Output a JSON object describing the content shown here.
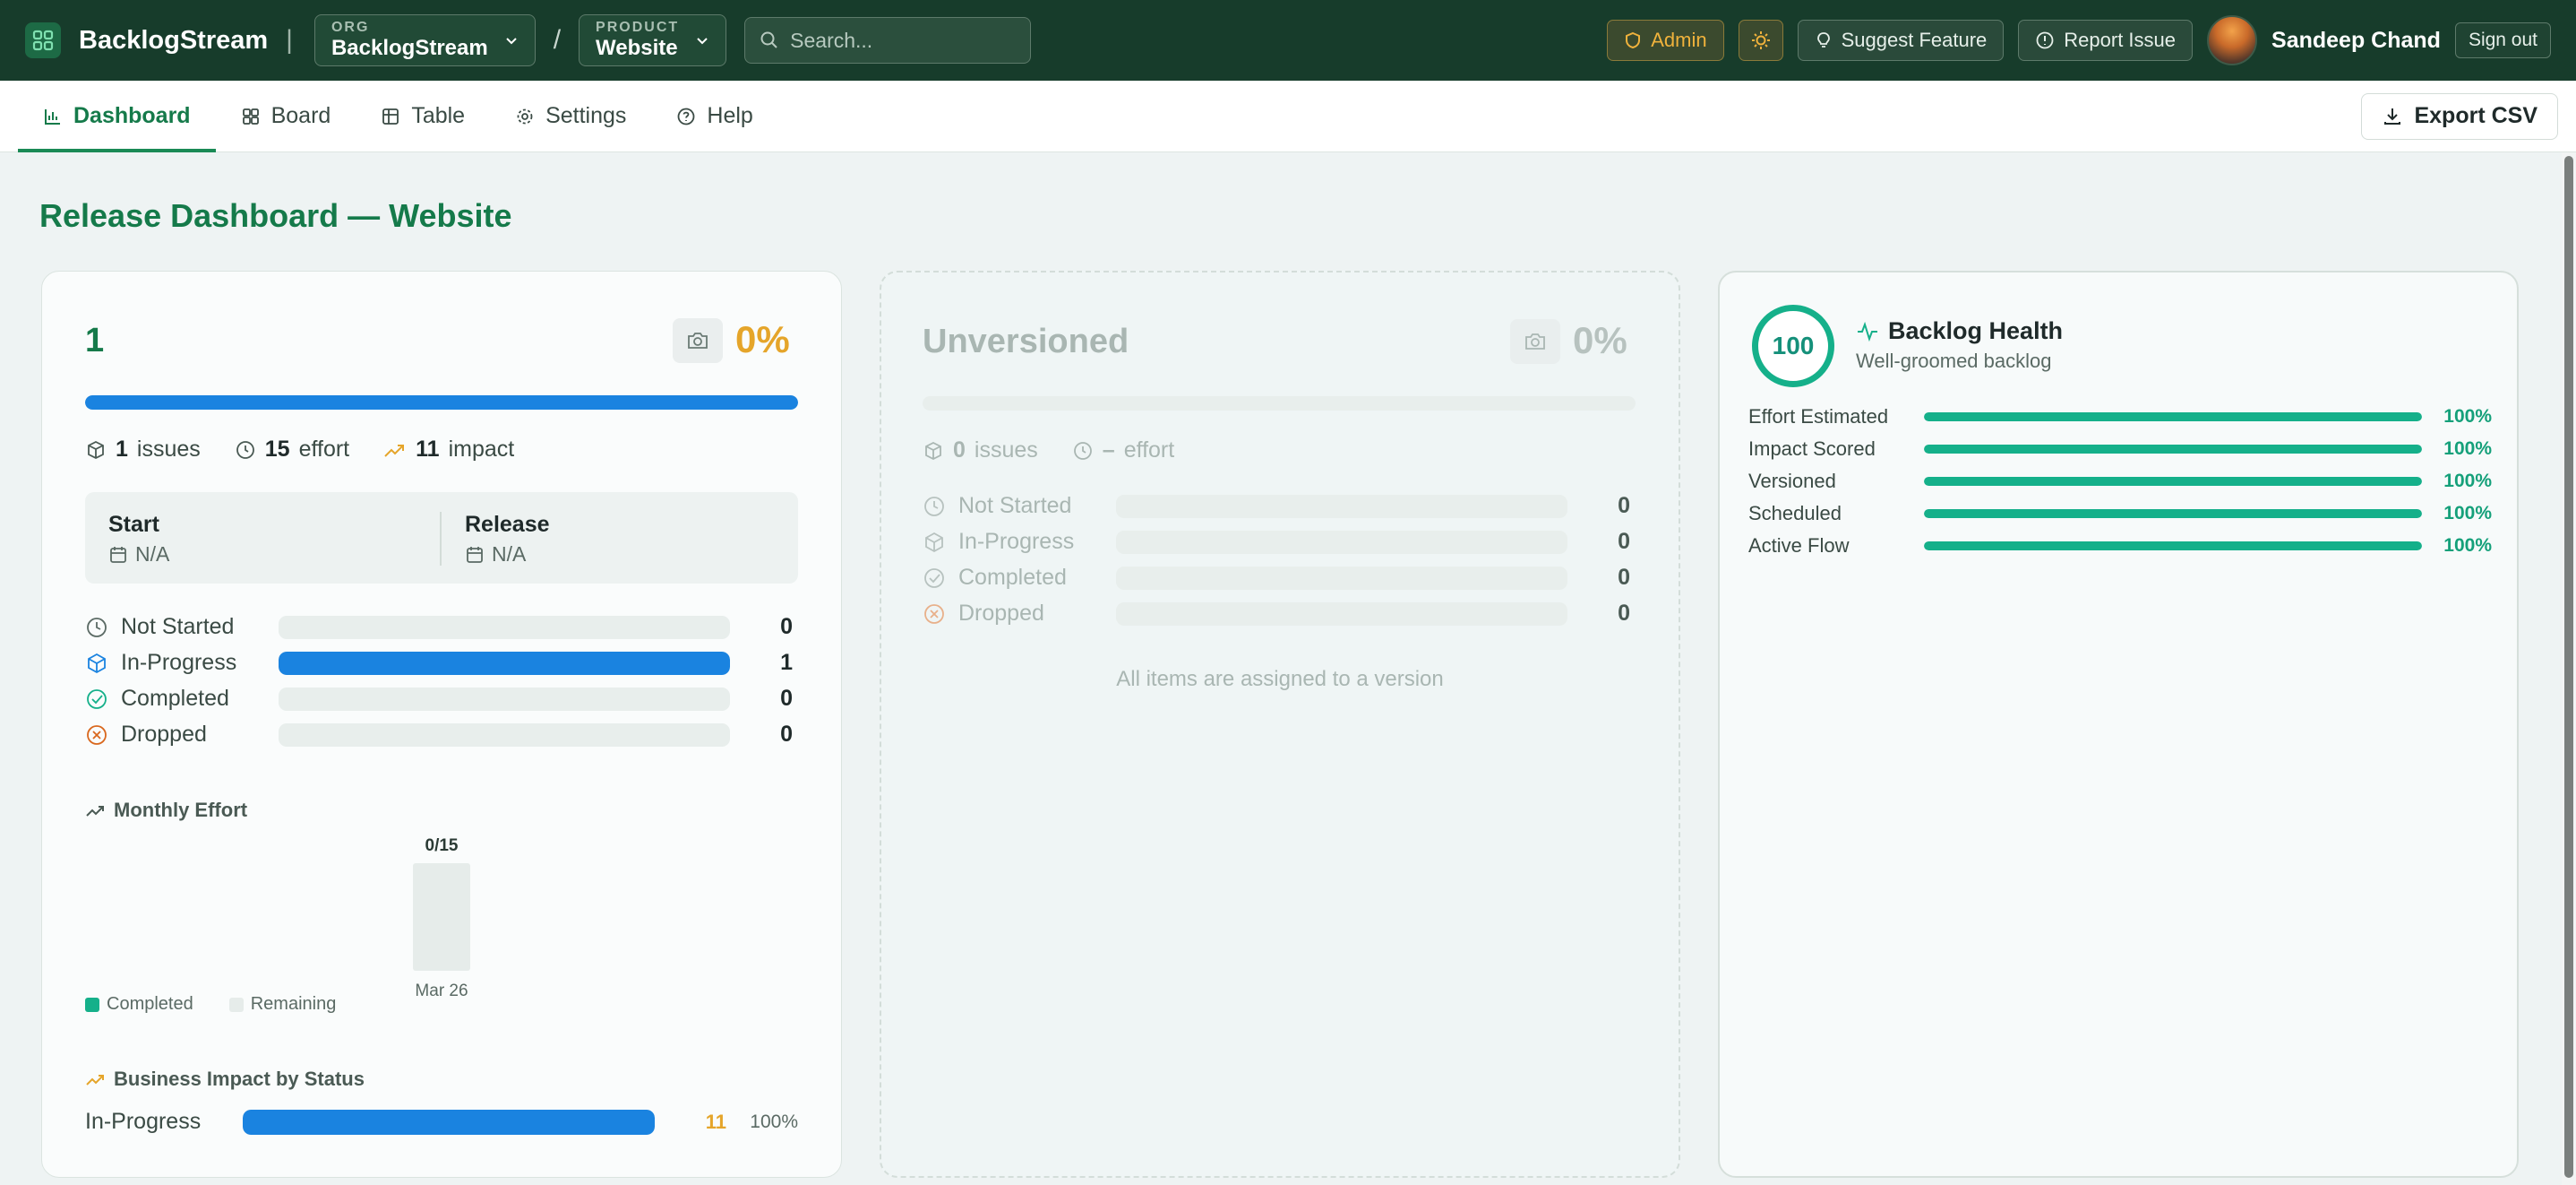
{
  "app": {
    "title": "BacklogStream"
  },
  "org": {
    "caption": "ORG",
    "value": "BacklogStream"
  },
  "product": {
    "caption": "PRODUCT",
    "value": "Website"
  },
  "search": {
    "placeholder": "Search..."
  },
  "topbar": {
    "admin": "Admin",
    "suggest": "Suggest Feature",
    "report": "Report Issue",
    "user": "Sandeep Chand",
    "signout": "Sign out"
  },
  "tabs": [
    {
      "label": "Dashboard",
      "icon": "bar-chart-icon",
      "active": true
    },
    {
      "label": "Board",
      "icon": "grid-icon"
    },
    {
      "label": "Table",
      "icon": "table-icon"
    },
    {
      "label": "Settings",
      "icon": "gear-icon"
    },
    {
      "label": "Help",
      "icon": "help-icon"
    }
  ],
  "export_label": "Export CSV",
  "page_title": "Release Dashboard — Website",
  "version_card": {
    "name": "1",
    "percent": "0%",
    "progress": 1.0,
    "issues_count": "1",
    "issues_label": "issues",
    "effort_count": "15",
    "effort_label": "effort",
    "impact_count": "11",
    "impact_label": "impact",
    "start_label": "Start",
    "start_value": "N/A",
    "release_label": "Release",
    "release_value": "N/A",
    "statuses": [
      {
        "label": "Not Started",
        "count": "0",
        "fill": 0,
        "color": "#5a6a64"
      },
      {
        "label": "In-Progress",
        "count": "1",
        "fill": 1.0,
        "color": "#1a83e0"
      },
      {
        "label": "Completed",
        "count": "0",
        "fill": 0,
        "color": "#15b08a"
      },
      {
        "label": "Dropped",
        "count": "0",
        "fill": 0,
        "color": "#d9681e"
      }
    ],
    "monthly_effort_title": "Monthly Effort",
    "business_impact_title": "Business Impact by Status",
    "business_impact": [
      {
        "label": "In-Progress",
        "value": "11",
        "percent": "100%",
        "fill": 1.0
      }
    ]
  },
  "unversioned_card": {
    "name": "Unversioned",
    "percent": "0%",
    "issues_count": "0",
    "issues_label": "issues",
    "effort_count": "–",
    "effort_label": "effort",
    "statuses": [
      {
        "label": "Not Started",
        "count": "0"
      },
      {
        "label": "In-Progress",
        "count": "0"
      },
      {
        "label": "Completed",
        "count": "0"
      },
      {
        "label": "Dropped",
        "count": "0"
      }
    ],
    "empty_message": "All items are assigned to a version"
  },
  "health_card": {
    "score": "100",
    "title": "Backlog Health",
    "subtitle": "Well-groomed backlog",
    "metrics": [
      {
        "label": "Effort Estimated",
        "value": "100%",
        "fill": 1.0
      },
      {
        "label": "Impact Scored",
        "value": "100%",
        "fill": 1.0
      },
      {
        "label": "Versioned",
        "value": "100%",
        "fill": 1.0
      },
      {
        "label": "Scheduled",
        "value": "100%",
        "fill": 1.0
      },
      {
        "label": "Active Flow",
        "value": "100%",
        "fill": 1.0
      }
    ]
  },
  "chart_data": {
    "type": "bar",
    "title": "Monthly Effort",
    "categories": [
      "Mar 26"
    ],
    "series": [
      {
        "name": "Completed",
        "values": [
          0
        ]
      },
      {
        "name": "Remaining",
        "values": [
          15
        ]
      }
    ],
    "data_labels": [
      "0/15"
    ],
    "legend": "bottom-left"
  },
  "colors": {
    "brand": "#157a4a",
    "topbar": "#173c2b",
    "accent_blue": "#1a83e0",
    "health_green": "#15b08a",
    "warning": "#e5a52a"
  }
}
